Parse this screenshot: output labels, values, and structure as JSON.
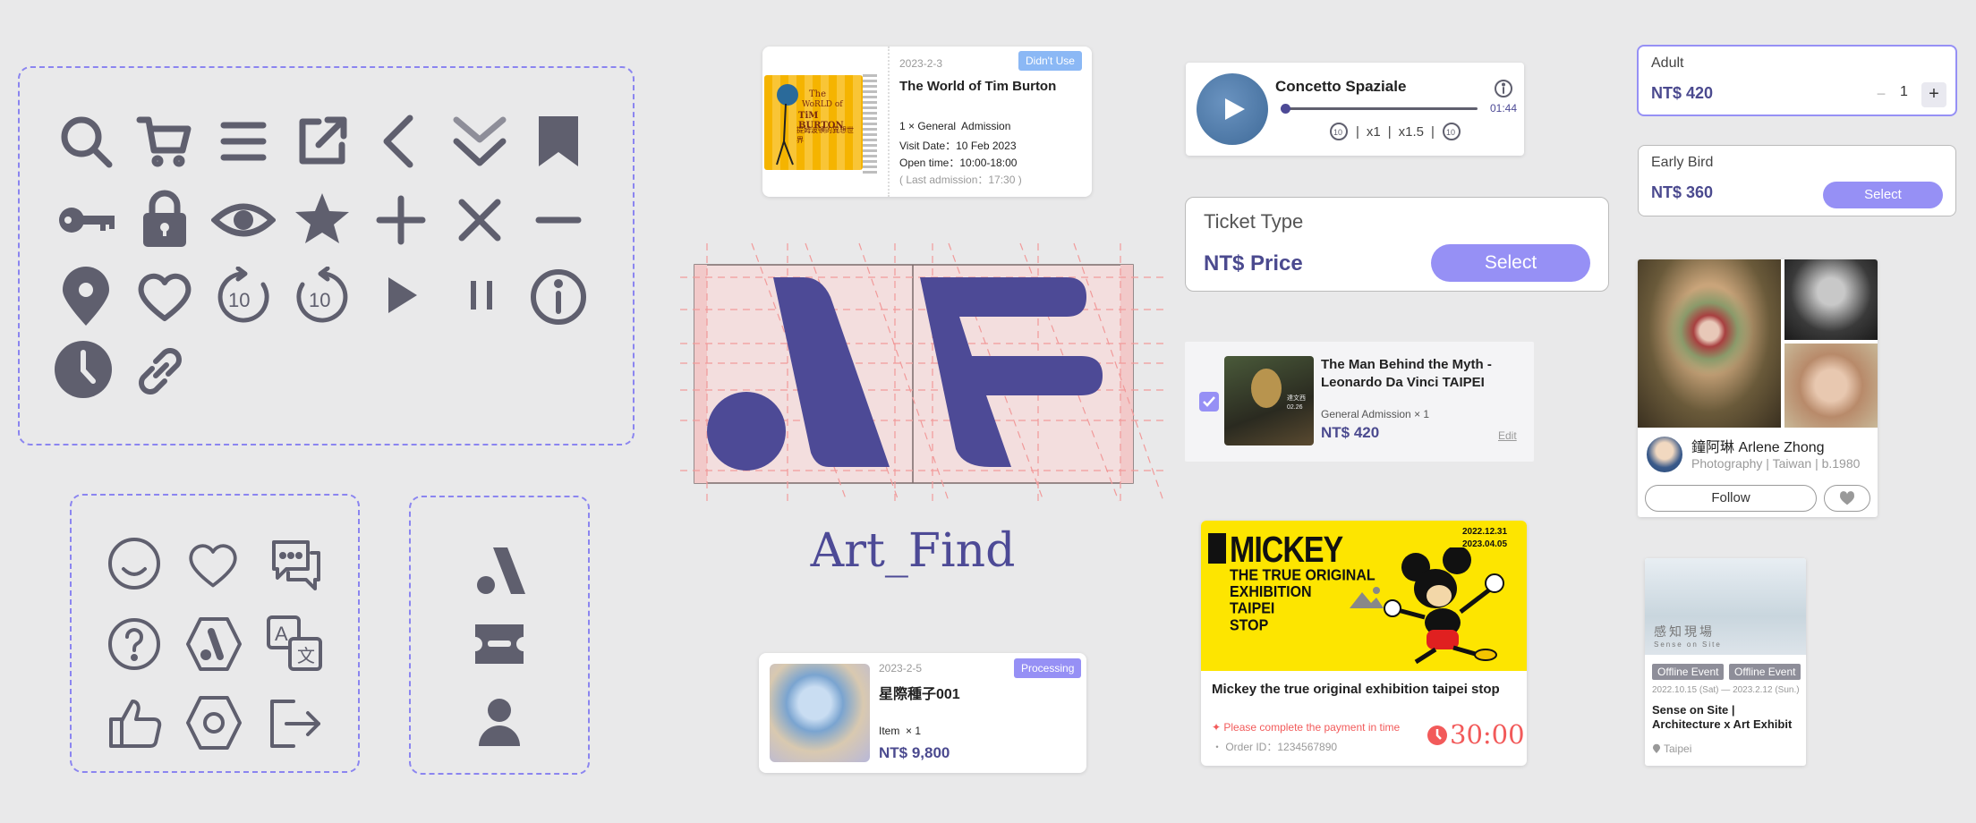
{
  "brand": {
    "name": "Art_Find",
    "accent": "#9690f5",
    "logo_color": "#4d4a96",
    "icon_color": "#5f5f6e"
  },
  "icon_sets": {
    "main": [
      "search-icon",
      "cart-icon",
      "menu-icon",
      "external-link-icon",
      "back-arrow-icon",
      "double-chevron-down-icon",
      "bookmark-icon",
      "key-icon",
      "lock-icon",
      "eye-icon",
      "star-icon",
      "plus-icon",
      "close-icon",
      "minus-icon",
      "location-pin-icon",
      "heart-icon",
      "replay-10-icon",
      "forward-10-icon",
      "play-icon",
      "pause-icon",
      "info-icon",
      "clock-icon",
      "link-icon"
    ],
    "secondary": [
      "smile-icon",
      "heart-outline-icon",
      "chat-icon",
      "help-icon",
      "hex-logo-icon",
      "translate-icon",
      "thumbs-up-icon",
      "settings-hex-icon",
      "logout-icon"
    ],
    "nav": [
      "logo-nav-icon",
      "ticket-icon",
      "user-icon"
    ]
  },
  "ticket_order": {
    "date": "2023-2-3",
    "status": "Didn't Use",
    "title": "The World of Tim Burton",
    "poster_top": "The",
    "poster_mid": "WoRLD of",
    "poster_name": "TiM BURTON",
    "poster_cn": "提姆波頓的異想世界",
    "quantity": "1 × General  Admission",
    "visit_date": "Visit Date：10 Feb 2023",
    "open_time": "Open time：10:00-18:00",
    "last_admission": "( Last admission：17:30 )"
  },
  "product_order": {
    "date": "2023-2-5",
    "status": "Processing",
    "title": "星際種子001",
    "quantity": "Item  × 1",
    "price": "NT$ 9,800"
  },
  "audio_player": {
    "title": "Concetto Spaziale",
    "time": "01:44",
    "speed_1": "x1",
    "speed_2": "x1.5",
    "progress": 0.01
  },
  "ticket_type_generic": {
    "label": "Ticket Type",
    "price": "NT$ Price",
    "button": "Select"
  },
  "cart_item": {
    "title": "The Man Behind the Myth - Leonardo Da Vinci TAIPEI",
    "ticket": "General Admission",
    "quantity": "× 1",
    "price": "NT$ 420",
    "edit": "Edit",
    "checked": true,
    "thumb_text_1": "達文西",
    "thumb_text_2": "02.26"
  },
  "payment_card": {
    "poster_title": "MICKEY",
    "poster_sub": [
      "THE TRUE ORIGINAL",
      "EXHIBITION",
      "TAIPEI",
      "STOP"
    ],
    "poster_dates": [
      "2022.12.31",
      "2023.04.05"
    ],
    "title": "Mickey the true original exhibition taipei stop",
    "warning": "✦ Please complete the payment in time",
    "order_id": "・ Order ID：1234567890",
    "countdown": "30:00"
  },
  "ticket_selector_adult": {
    "label": "Adult",
    "price": "NT$ 420",
    "qty": "1",
    "minus": "−",
    "plus": "+"
  },
  "ticket_selector_early": {
    "label": "Early Bird",
    "price": "NT$ 360",
    "button": "Select"
  },
  "artist_card": {
    "name": "鐘阿琳 Arlene Zhong",
    "field": "Photography",
    "country": "Taiwan",
    "birth": "b.1980",
    "follow": "Follow"
  },
  "event_card": {
    "tag1": "Offline Event",
    "tag2": "Offline Event",
    "date_start": "2022.10.15 (Sat)",
    "date_end": "2023.2.12 (Sun.)",
    "title": "Sense on Site | Architecture x Art Exhibit",
    "location": "Taipei",
    "poster_cn": "感知現場",
    "poster_en": "Sense on Site"
  }
}
